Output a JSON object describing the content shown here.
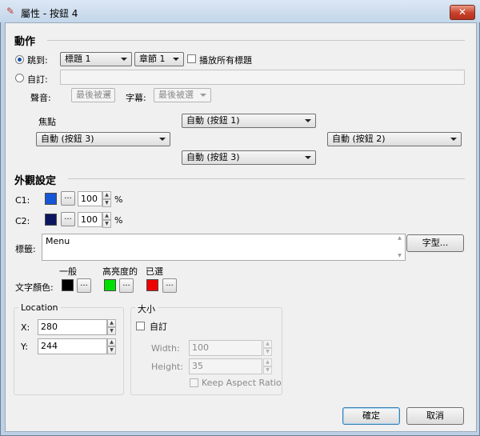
{
  "window": {
    "title": "屬性 - 按鈕 4",
    "close_glyph": "✕"
  },
  "action": {
    "section_title": "動作",
    "goto_label": "跳到:",
    "goto_title_value": "標題 1",
    "goto_chapter_value": "章節 1",
    "play_all_label": "播放所有標題",
    "custom_label": "自訂:",
    "custom_value": "",
    "audio_label": "聲音:",
    "audio_value": "最後被選",
    "subtitle_label": "字幕:",
    "subtitle_value": "最後被選",
    "focus_label": "焦點",
    "focus_up": "自動 (按鈕 1)",
    "focus_left": "自動 (按鈕 3)",
    "focus_right": "自動 (按鈕 2)",
    "focus_down": "自動 (按鈕 3)"
  },
  "appearance": {
    "section_title": "外觀設定",
    "c1_label": "C1:",
    "c1_color": "#1556d6",
    "c1_value": "100",
    "c2_label": "C2:",
    "c2_color": "#0c1660",
    "c2_value": "100",
    "percent": "%",
    "ellipsis": "...",
    "caption_label": "標籤:",
    "caption_value": "Menu",
    "font_button": "字型...",
    "text_color_label": "文字顏色:",
    "normal_label": "一般",
    "highlight_label": "高亮度的",
    "selected_label": "已選",
    "normal_color": "#000000",
    "highlight_color": "#00e000",
    "selected_color": "#ee0000"
  },
  "location": {
    "title": "Location",
    "x_label": "X:",
    "x_value": "280",
    "y_label": "Y:",
    "y_value": "244"
  },
  "size": {
    "title": "大小",
    "custom_label": "自訂",
    "width_label": "Width:",
    "width_value": "100",
    "height_label": "Height:",
    "height_value": "35",
    "keep_aspect_label": "Keep Aspect Ratio"
  },
  "buttons": {
    "ok": "確定",
    "cancel": "取消"
  },
  "colors": {
    "accent": "#1a52a6",
    "client_bg": "#f0f0f0"
  }
}
